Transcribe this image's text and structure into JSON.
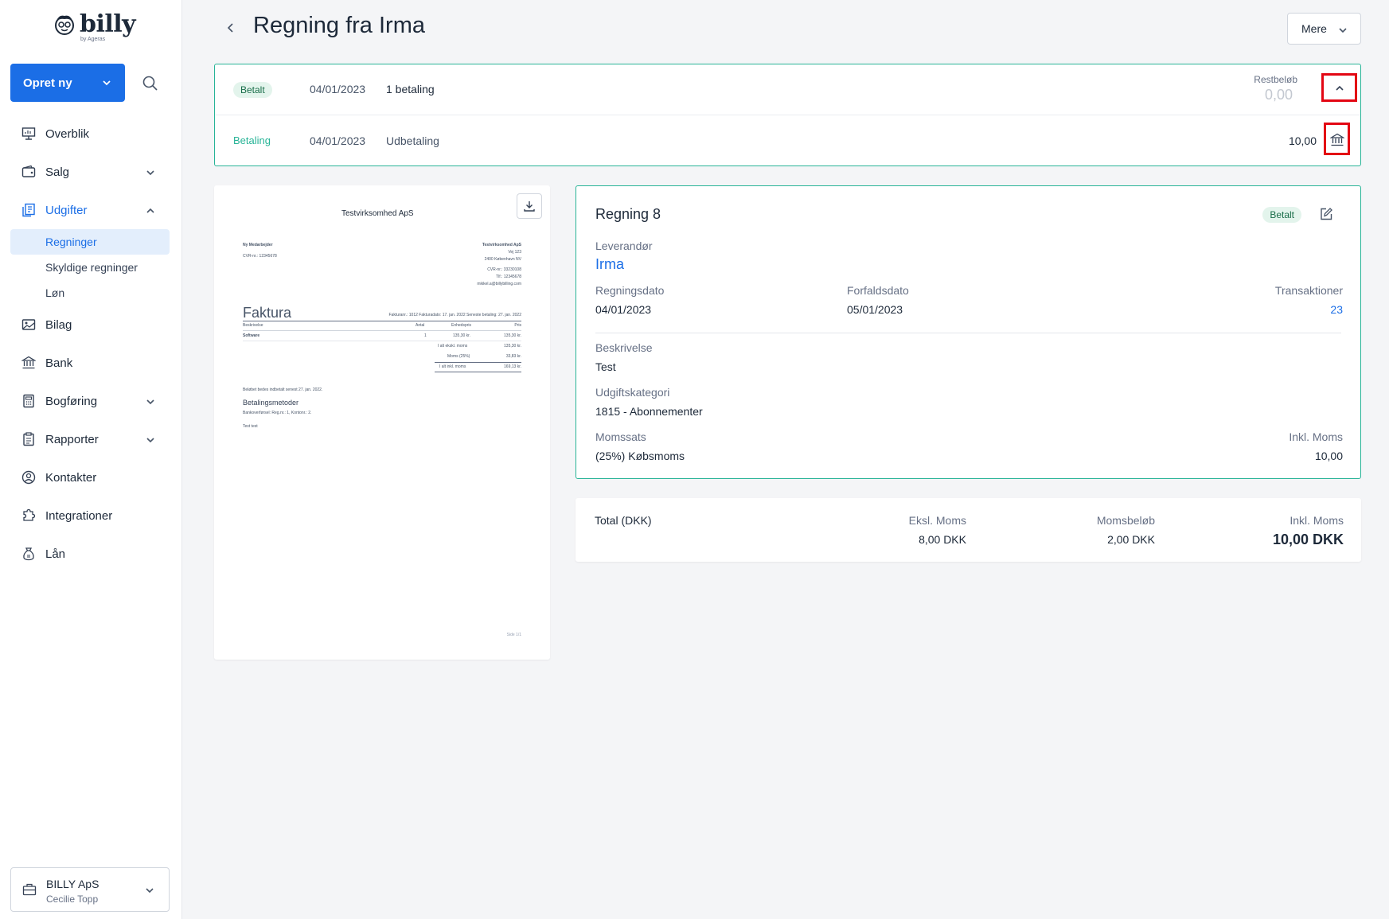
{
  "app": {
    "logo_text": "billy",
    "logo_sub": "by Ageras"
  },
  "sidebar": {
    "create_label": "Opret ny",
    "items": [
      {
        "label": "Overblik",
        "icon": "chart-board-icon"
      },
      {
        "label": "Salg",
        "icon": "wallet-icon"
      },
      {
        "label": "Udgifter",
        "icon": "receipt-icon"
      },
      {
        "label": "Bilag",
        "icon": "image-icon"
      },
      {
        "label": "Bank",
        "icon": "bank-icon"
      },
      {
        "label": "Bogføring",
        "icon": "calculator-icon"
      },
      {
        "label": "Rapporter",
        "icon": "report-icon"
      },
      {
        "label": "Kontakter",
        "icon": "user-circle-icon"
      },
      {
        "label": "Integrationer",
        "icon": "puzzle-icon"
      },
      {
        "label": "Lån",
        "icon": "money-bag-icon"
      }
    ],
    "subitems": [
      "Regninger",
      "Skyldige regninger",
      "Løn"
    ],
    "company": {
      "name": "BILLY ApS",
      "user": "Cecilie Topp"
    }
  },
  "header": {
    "title": "Regning fra Irma",
    "more_label": "Mere"
  },
  "payments": {
    "row1": {
      "badge": "Betalt",
      "date": "04/01/2023",
      "desc": "1 betaling",
      "rest_label": "Restbeløb",
      "rest_value": "0,00"
    },
    "row2": {
      "type": "Betaling",
      "date": "04/01/2023",
      "desc": "Udbetaling",
      "amount": "10,00"
    }
  },
  "document": {
    "company": "Testvirksomhed ApS",
    "left_lines": [
      "Ny Medarbejder",
      "CVR-nr.: 12345678"
    ],
    "right_lines": [
      "Testvirksomhed ApS",
      "Vej 123",
      "2400 København NV",
      "CVR-nr.: 33230108",
      "Tlf.: 12345678",
      "mikkel.a@billybilling.com"
    ],
    "heading": "Faktura",
    "meta": "Fakturanr.: 1012    Fakturadato: 17. jan. 2022    Seneste betaling: 27. jan. 2022",
    "table_header": [
      "Beskrivelse",
      "Antal",
      "Enhedspris",
      "Pris"
    ],
    "table_row": [
      "Software",
      "1",
      "135,30 kr.",
      "135,30 kr."
    ],
    "totals": [
      [
        "I alt ekskl. moms",
        "135,30 kr."
      ],
      [
        "Moms (25%)",
        "33,83 kr."
      ],
      [
        "I alt inkl. moms",
        "169,13 kr."
      ]
    ],
    "payment_note": "Beløbet bedes indbetalt senest 27. jan. 2022.",
    "methods_title": "Betalingsmetoder",
    "methods_text": "Bankoverførsel: Reg.nr.: 1, Kontonr.: 2.",
    "footer_text": "Test test",
    "page_no": "Side 1/1"
  },
  "bill": {
    "title": "Regning 8",
    "status": "Betalt",
    "supplier_label": "Leverandør",
    "supplier": "Irma",
    "date_label": "Regningsdato",
    "date": "04/01/2023",
    "due_label": "Forfaldsdato",
    "due": "05/01/2023",
    "tx_label": "Transaktioner",
    "tx": "23",
    "desc_label": "Beskrivelse",
    "desc": "Test",
    "cat_label": "Udgiftskategori",
    "cat": "1815 - Abonnementer",
    "vat_label": "Momssats",
    "vat": "(25%) Købsmoms",
    "incl_label": "Inkl. Moms",
    "incl": "10,00"
  },
  "totals": {
    "label": "Total (DKK)",
    "excl_label": "Eksl. Moms",
    "excl": "8,00 DKK",
    "vat_label": "Momsbeløb",
    "vat": "2,00 DKK",
    "incl_label": "Inkl. Moms",
    "incl": "10,00 DKK"
  },
  "colors": {
    "accent": "#1b6ee6",
    "paid_border": "#28b497",
    "highlight": "#e30613"
  }
}
